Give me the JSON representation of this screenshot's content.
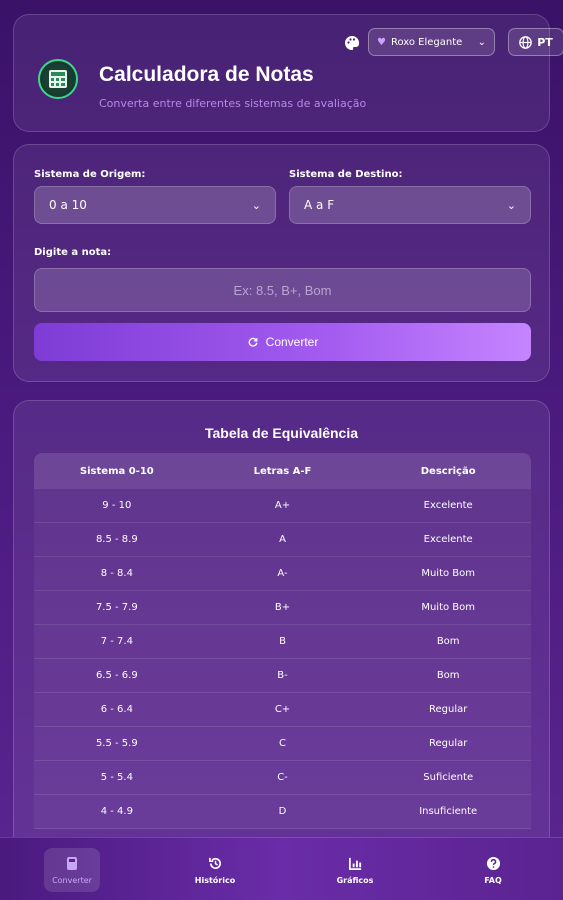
{
  "header": {
    "title": "Calculadora de Notas",
    "subtitle": "Converta entre diferentes sistemas de avaliação",
    "theme_select": "Roxo Elegante",
    "language": "PT"
  },
  "converter": {
    "source_label": "Sistema de Origem:",
    "source_value": "0 a 10",
    "target_label": "Sistema de Destino:",
    "target_value": "A a F",
    "input_label": "Digite a nota:",
    "input_placeholder": "Ex: 8.5, B+, Bom",
    "convert_label": "Converter"
  },
  "table": {
    "title": "Tabela de Equivalência",
    "headers": [
      "Sistema 0-10",
      "Letras A-F",
      "Descrição"
    ],
    "rows": [
      [
        "9 - 10",
        "A+",
        "Excelente"
      ],
      [
        "8.5 - 8.9",
        "A",
        "Excelente"
      ],
      [
        "8 - 8.4",
        "A-",
        "Muito Bom"
      ],
      [
        "7.5 - 7.9",
        "B+",
        "Muito Bom"
      ],
      [
        "7 - 7.4",
        "B",
        "Bom"
      ],
      [
        "6.5 - 6.9",
        "B-",
        "Bom"
      ],
      [
        "6 - 6.4",
        "C+",
        "Regular"
      ],
      [
        "5.5 - 5.9",
        "C",
        "Regular"
      ],
      [
        "5 - 5.4",
        "C-",
        "Suficiente"
      ],
      [
        "4 - 4.9",
        "D",
        "Insuficiente"
      ]
    ]
  },
  "nav": {
    "items": [
      {
        "label": "Converter",
        "icon": "calculator-icon",
        "active": true
      },
      {
        "label": "Histórico",
        "icon": "history-icon",
        "active": false
      },
      {
        "label": "Gráficos",
        "icon": "chart-icon",
        "active": false
      },
      {
        "label": "FAQ",
        "icon": "question-icon",
        "active": false
      }
    ]
  },
  "colors": {
    "accent": "#a45cf0",
    "subtitle": "#b68ae8",
    "logo_ring": "#3dd68c"
  }
}
